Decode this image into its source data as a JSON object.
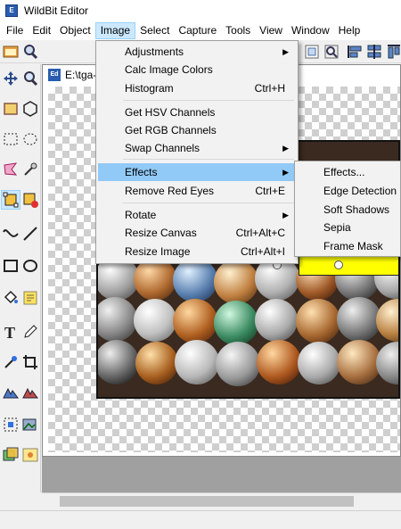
{
  "window": {
    "title": "WildBit Editor"
  },
  "menubar": {
    "items": [
      "File",
      "Edit",
      "Object",
      "Image",
      "Select",
      "Capture",
      "Tools",
      "View",
      "Window",
      "Help"
    ],
    "active": "Image"
  },
  "document": {
    "title": "E:\\tga-"
  },
  "image_menu": {
    "items": [
      {
        "label": "Adjustments",
        "shortcut": "",
        "submenu": true
      },
      {
        "label": "Calc Image Colors",
        "shortcut": "",
        "submenu": false
      },
      {
        "label": "Histogram",
        "shortcut": "Ctrl+H",
        "submenu": false
      },
      {
        "label": "Get HSV Channels",
        "shortcut": "",
        "submenu": false
      },
      {
        "label": "Get RGB Channels",
        "shortcut": "",
        "submenu": false
      },
      {
        "label": "Swap Channels",
        "shortcut": "",
        "submenu": true
      },
      {
        "label": "Effects",
        "shortcut": "",
        "submenu": true
      },
      {
        "label": "Remove Red Eyes",
        "shortcut": "Ctrl+E",
        "submenu": false
      },
      {
        "label": "Rotate",
        "shortcut": "",
        "submenu": true
      },
      {
        "label": "Resize Canvas",
        "shortcut": "Ctrl+Alt+C",
        "submenu": false
      },
      {
        "label": "Resize Image",
        "shortcut": "Ctrl+Alt+I",
        "submenu": false
      }
    ],
    "highlighted": "Effects"
  },
  "effects_submenu": {
    "items": [
      "Effects...",
      "Edge Detection",
      "Soft Shadows",
      "Sepia",
      "Frame Mask"
    ]
  },
  "colors": {
    "highlight": "#91c9f7",
    "menu_active": "#cce8ff",
    "shape_fill": "#ffff00"
  }
}
